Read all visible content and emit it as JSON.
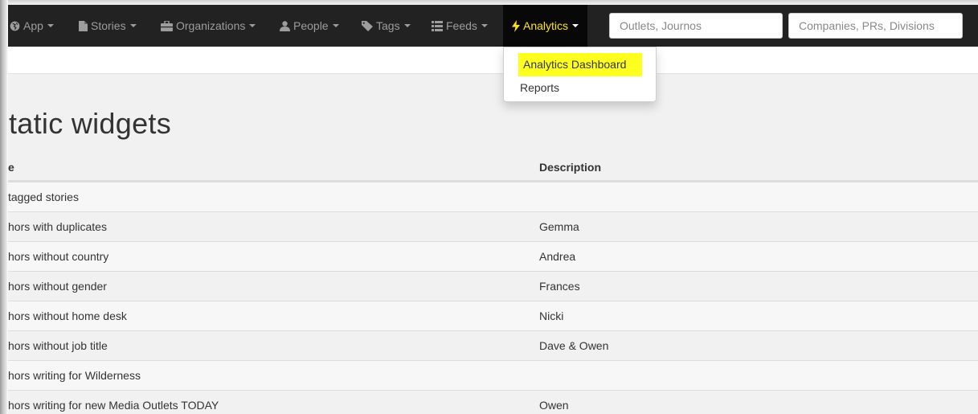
{
  "navbar": {
    "items": [
      {
        "label": "App",
        "icon": "globe-icon"
      },
      {
        "label": "Stories",
        "icon": "file-icon"
      },
      {
        "label": "Organizations",
        "icon": "briefcase-icon"
      },
      {
        "label": "People",
        "icon": "user-icon"
      },
      {
        "label": "Tags",
        "icon": "tag-icon"
      },
      {
        "label": "Feeds",
        "icon": "list-icon"
      },
      {
        "label": "Analytics",
        "icon": "flash-icon",
        "active": true
      }
    ],
    "search_outlets_placeholder": "Outlets, Journos",
    "search_companies_placeholder": "Companies, PRs, Divisions"
  },
  "analytics_menu": {
    "items": [
      {
        "label": "Analytics Dashboard",
        "highlighted": true
      },
      {
        "label": "Reports"
      }
    ]
  },
  "page": {
    "title": "tatic widgets"
  },
  "table": {
    "headers": {
      "name": "e",
      "description": "Description"
    },
    "rows": [
      {
        "name": "tagged stories",
        "description": ""
      },
      {
        "name": "hors with duplicates",
        "description": "Gemma"
      },
      {
        "name": "hors without country",
        "description": "Andrea"
      },
      {
        "name": "hors without gender",
        "description": "Frances"
      },
      {
        "name": "hors without home desk",
        "description": "Nicki"
      },
      {
        "name": "hors without job title",
        "description": "Dave & Owen"
      },
      {
        "name": "hors writing for Wilderness",
        "description": ""
      },
      {
        "name": "hors writing for new Media Outlets TODAY",
        "description": "Owen"
      }
    ]
  },
  "colors": {
    "navbar_bg": "#222222",
    "active_text": "#ffe600",
    "highlight": "#ffff1f"
  }
}
